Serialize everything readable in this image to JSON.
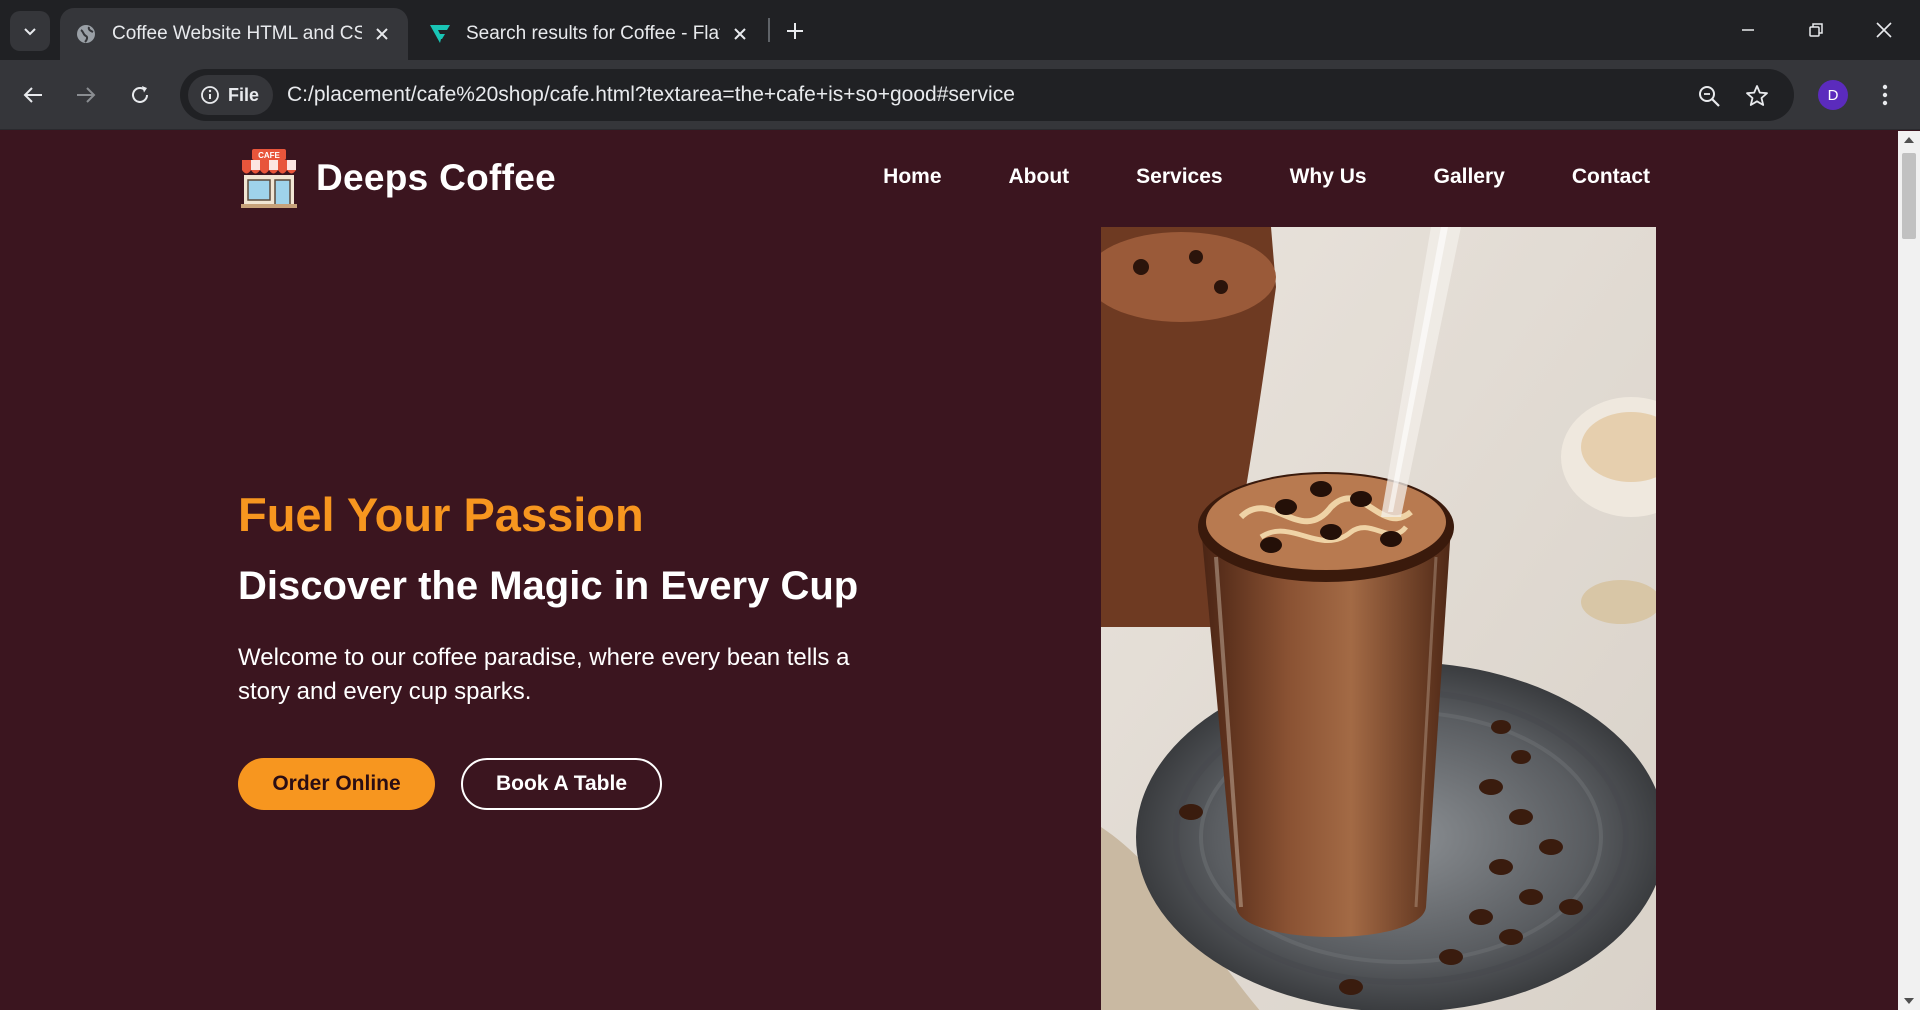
{
  "browser": {
    "tabs": [
      {
        "title": "Coffee Website HTML and CSS",
        "icon": "globe-icon",
        "active": true
      },
      {
        "title": "Search results for Coffee - Flaticon",
        "icon": "flaticon-icon",
        "active": false
      }
    ],
    "address": {
      "chip_label": "File",
      "url": "C:/placement/cafe%20shop/cafe.html?textarea=the+cafe+is+so+good#service"
    },
    "profile_initial": "D"
  },
  "site": {
    "brand": "Deeps Coffee",
    "logo_sign_text": "CAFE",
    "nav": [
      "Home",
      "About",
      "Services",
      "Why Us",
      "Gallery",
      "Contact"
    ],
    "hero": {
      "kicker": "Fuel Your Passion",
      "headline": "Discover the Magic in Every Cup",
      "description": "Welcome to our coffee paradise, where every bean tells a story and every cup sparks.",
      "primary_button": "Order Online",
      "secondary_button": "Book A Table"
    }
  },
  "colors": {
    "page_background": "#3b151f",
    "accent": "#f7961f",
    "text": "#ffffff",
    "chrome_dark": "#202124",
    "chrome_toolbar": "#35363a"
  }
}
